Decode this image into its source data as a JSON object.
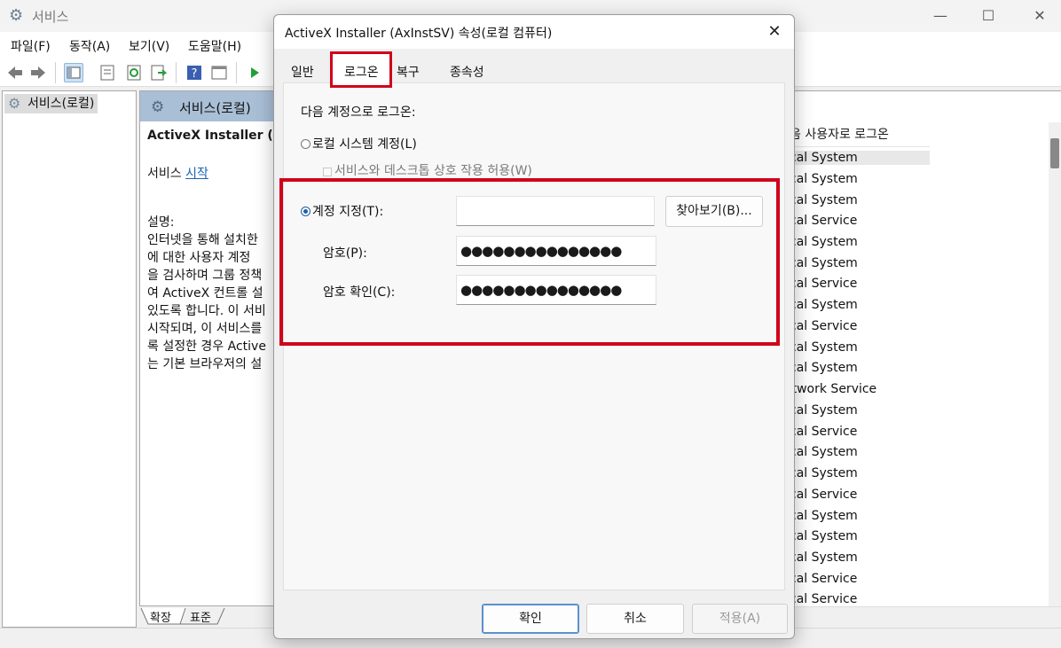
{
  "window": {
    "title": "서비스",
    "icon": "gear-icon",
    "minimize": "—",
    "maximize": "☐",
    "close": "✕"
  },
  "menu": [
    "파일(F)",
    "동작(A)",
    "보기(V)",
    "도움말(H)"
  ],
  "toolbar_icons": [
    "back-icon",
    "forward-icon",
    "console-tree-icon",
    "properties-icon",
    "refresh-icon",
    "export-icon",
    "help-icon",
    "view-icon",
    "play-icon"
  ],
  "tree": {
    "root": "서비스(로컬)"
  },
  "details": {
    "header": "서비스(로컬)",
    "service_name": "ActiveX Installer (Ax",
    "start_prefix": "서비스 ",
    "start_link": "시작",
    "desc_label": "설명:",
    "desc_lines": [
      "인터넷을 통해 설치한",
      "에 대한 사용자 계정",
      "을 검사하며 그룹 정책",
      "여 ActiveX 컨트롤 설",
      "있도록 합니다. 이 서비",
      "시작되며, 이 서비스를",
      "록 설정한 경우 Active",
      "는 기본 브라우저의 설"
    ]
  },
  "list": {
    "column_header": "음 사용자로 로그온",
    "logon_as": [
      "cal System",
      "cal System",
      "cal System",
      "cal Service",
      "cal System",
      "cal System",
      "cal Service",
      "cal System",
      "cal Service",
      "cal System",
      "cal System",
      "etwork Service",
      "cal System",
      "cal Service",
      "cal System",
      "cal System",
      "cal Service",
      "cal System",
      "cal System",
      "cal System",
      "cal Service",
      "cal Service"
    ]
  },
  "bottom_tabs": [
    "확장",
    "표준"
  ],
  "dialog": {
    "title": "ActiveX Installer (AxInstSV) 속성(로컬 컴퓨터)",
    "close": "✕",
    "tabs": {
      "general": "일반",
      "logon": "로그온",
      "recovery": "복구",
      "dependencies": "종속성"
    },
    "logon_as_label": "다음 계정으로 로그온:",
    "local_system": "로컬 시스템 계정(L)",
    "allow_desktop": "서비스와 데스크톱 상호 작용 허용(W)",
    "this_account": "계정 지정(T):",
    "account_value": "",
    "browse": "찾아보기(B)...",
    "password_label": "암호(P):",
    "password_value": "●●●●●●●●●●●●●●●",
    "confirm_label": "암호 확인(C):",
    "confirm_value": "●●●●●●●●●●●●●●●",
    "ok": "확인",
    "cancel": "취소",
    "apply": "적용(A)"
  }
}
